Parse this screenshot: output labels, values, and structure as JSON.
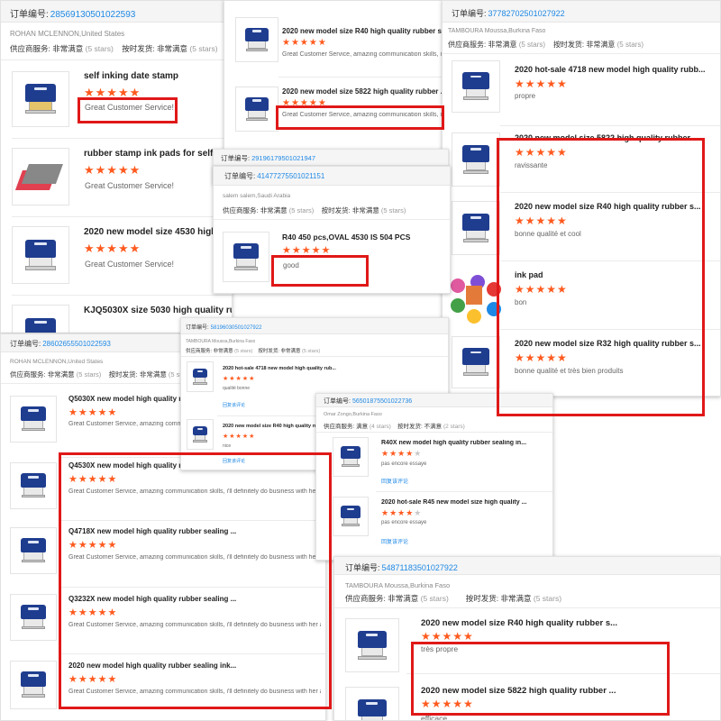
{
  "labels": {
    "order_no": "订单编号:",
    "supplier_service": "供应商服务:",
    "ship_on_time": "按时发货:",
    "very_satisfied": "非常满意",
    "satisfied": "满意",
    "not_satisfied": "不满意",
    "five_stars": "(5 stars)",
    "four_stars": "(4 stars)",
    "two_stars": "(2 stars)",
    "reply_link": "回复该评论"
  },
  "accent_colors": {
    "star": "#ff5a1f",
    "link": "#1e88e5",
    "highlight": "#e01818",
    "stamp": "#1f3d8f"
  },
  "icons": [
    "stamp-product-image",
    "ink-pad-image",
    "star-icon"
  ],
  "c1": {
    "order_number": "28569130501022593",
    "buyer": "ROHAN MCLENNON,United States",
    "items": [
      {
        "title": "self inking date stamp",
        "review": "Great Customer Service!"
      },
      {
        "title": "rubber stamp ink pads for self Ink",
        "review": "Great Customer Service!"
      },
      {
        "title": "2020 new model size 4530 high",
        "review": "Great Customer Service!"
      },
      {
        "title": "KJQ5030X size 5030 high quality rubber sealing"
      }
    ]
  },
  "c2": {
    "items": [
      {
        "title": "2020 new model size R40 high quality rubber s...",
        "review": "Great Customer Service,  amazing communication skills, i'l"
      },
      {
        "title": "2020 new model size 5822 high quality rubber ...",
        "review": "Great Customer Service,  amazing communication skills, i'l"
      }
    ]
  },
  "c3": {
    "order_number": "37782702501027922",
    "buyer": "TAMBOURA Moussa,Burkina Faso",
    "items": [
      {
        "title": "2020 hot-sale 4718 new model high quality rubb...",
        "review": "propre"
      },
      {
        "title": "2020 new model size 5822 high quality rubber ...",
        "review": "ravissante"
      },
      {
        "title": "2020 new model size R40 high quality rubber s...",
        "review": "bonne qualité et cool"
      },
      {
        "title": "ink pad",
        "review": "bon"
      },
      {
        "title": "2020 new model size R32 high quality rubber s...",
        "review": "bonne qualité et très bien produits"
      }
    ]
  },
  "c4": {
    "order_number": "29196179501021947"
  },
  "c5": {
    "order_number": "41477275501021151",
    "buyer": "salem salem,Saudi Arabia",
    "items": [
      {
        "title": "R40 450 pcs,OVAL 4530 IS 504 PCS",
        "review": "good"
      }
    ]
  },
  "c6": {
    "order_number": "28602655501022593",
    "buyer": "ROHAN MCLENNON,United States",
    "items": [
      {
        "title": "Q5030X new model high quality rubl",
        "review": "Great Customer Service,  amazing commun"
      },
      {
        "title": "Q4530X new model high quality rubl",
        "review": "Great Customer Service,  amazing communication skills, i'll definitely do business with her"
      },
      {
        "title": "Q4718X new model high quality rubber sealing ...",
        "review": "Great Customer Service,  amazing communication skills, i'll definitely do business with her"
      },
      {
        "title": "Q3232X new model high quality rubber sealing ...",
        "review": "Great Customer Service,  amazing communication skills, i'll definitely do business with her aga"
      },
      {
        "title": "2020 new model high quality rubber sealing ink...",
        "review": "Great Customer Service,  amazing communication skills, i'll definitely do business with her aga"
      }
    ]
  },
  "c7": {
    "order_number": "58196030501027922",
    "buyer": "TAMBOURA Moussa,Burkina Faso",
    "items": [
      {
        "title": "2020 hot-sale 4718 new model high quality rub...",
        "review": "qualité bonne"
      },
      {
        "title": "2020 new model size R40 high quality rubber s...",
        "review": "nice"
      }
    ]
  },
  "c8": {
    "order_number": "56501875501022736",
    "buyer": "Omar Zongo,Burkina Faso",
    "items": [
      {
        "title": "R40X new model high quality rubber sealing in...",
        "review": "pas encore essayé"
      },
      {
        "title": "2020 hot-sale R45 new model size high quality ...",
        "review": "pas encore essayé"
      }
    ]
  },
  "c9": {
    "order_number": "54871183501027922",
    "buyer": "TAMBOURA Moussa,Burkina Faso",
    "items": [
      {
        "title": "2020 new model size R40 high quality rubber s...",
        "review": "très propre"
      },
      {
        "title": "2020 new model size 5822 high quality rubber ...",
        "review": "efficace"
      }
    ]
  }
}
